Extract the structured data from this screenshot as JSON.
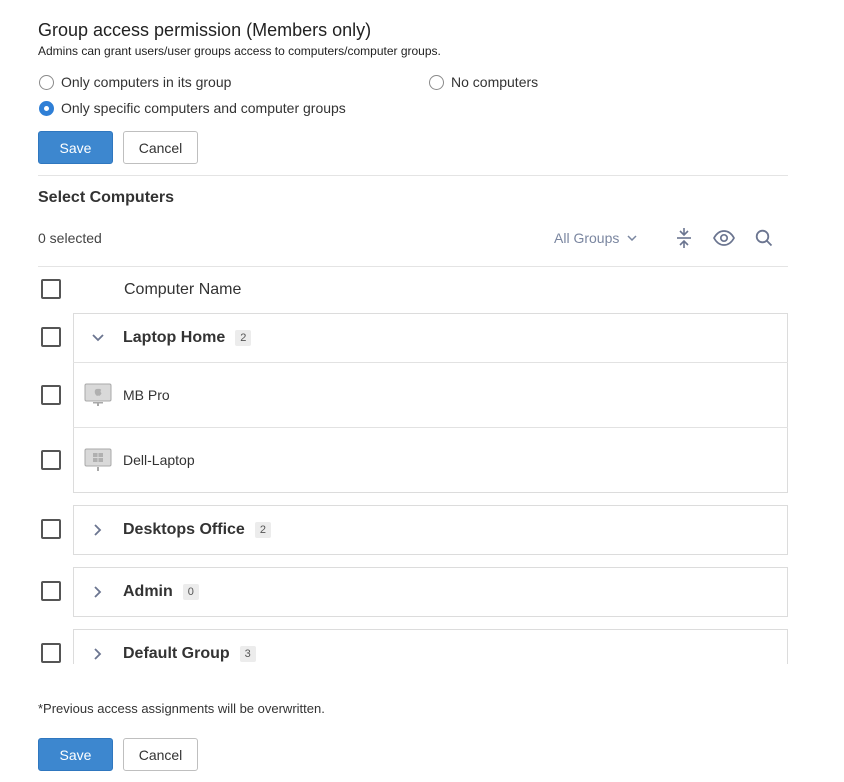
{
  "header": {
    "title": "Group access permission (Members only)",
    "subtitle": "Admins can grant users/user groups access to computers/computer groups."
  },
  "options": {
    "only_group": "Only computers in its group",
    "no_computers": "No computers",
    "specific": "Only specific computers and computer groups",
    "selected": "specific"
  },
  "buttons": {
    "save": "Save",
    "cancel": "Cancel"
  },
  "select_section": {
    "title": "Select Computers",
    "selected_count": "0 selected",
    "filter_label": "All Groups",
    "column_header": "Computer Name"
  },
  "groups": [
    {
      "name": "Laptop Home",
      "count": "2",
      "expanded": true,
      "computers": [
        {
          "name": "MB Pro",
          "os": "mac-icon"
        },
        {
          "name": "Dell-Laptop",
          "os": "windows-icon"
        }
      ]
    },
    {
      "name": "Desktops Office",
      "count": "2",
      "expanded": false
    },
    {
      "name": "Admin",
      "count": "0",
      "expanded": false
    },
    {
      "name": "Default Group",
      "count": "3",
      "expanded": false
    }
  ],
  "footer": {
    "note": "*Previous access assignments will be overwritten."
  },
  "colors": {
    "primary": "#3d87cf",
    "radio_selected": "#2f7fd6",
    "muted_link": "#7a86a0"
  }
}
